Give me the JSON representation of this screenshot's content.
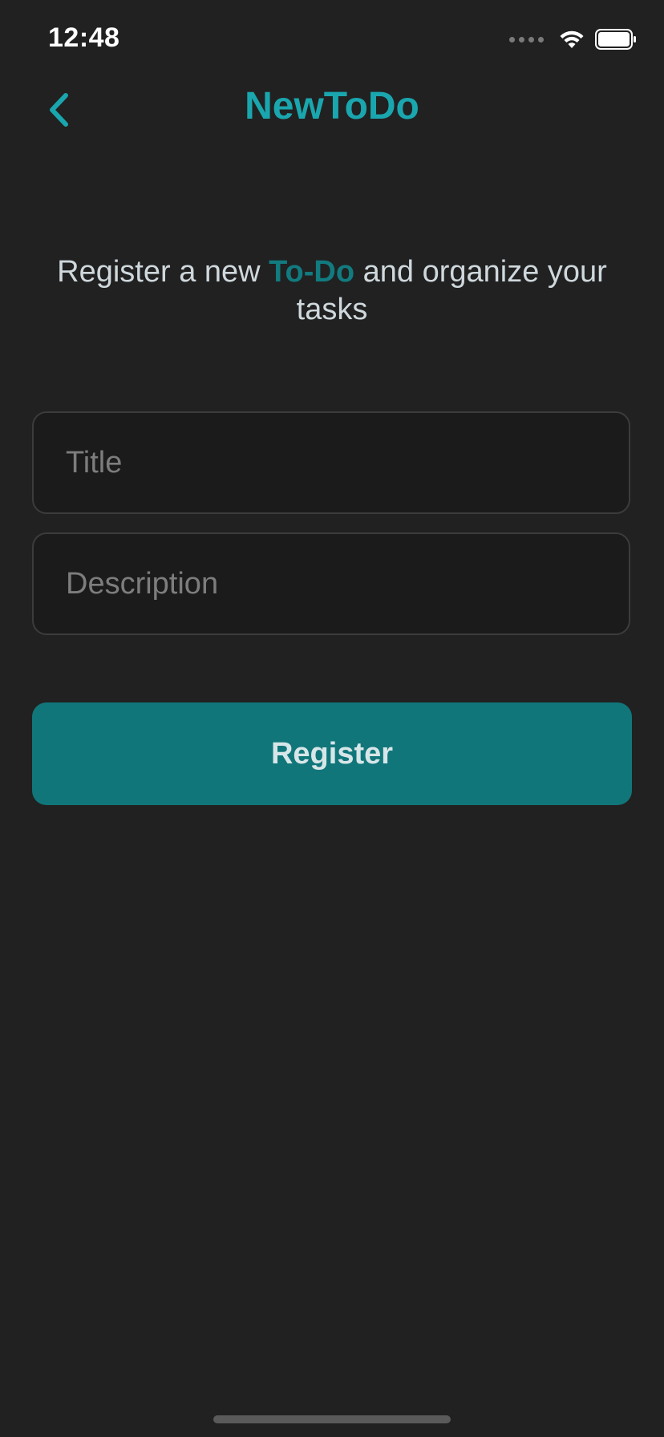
{
  "status_bar": {
    "time": "12:48",
    "signal_icon": "cellular-signal-icon",
    "wifi_icon": "wifi-icon",
    "battery_icon": "battery-icon"
  },
  "nav": {
    "title": "NewToDo",
    "back_icon": "chevron-left-icon"
  },
  "intro": {
    "prefix": "Register a new ",
    "highlight": "To-Do",
    "suffix": " and organize your tasks"
  },
  "form": {
    "title_placeholder": "Title",
    "title_value": "",
    "description_placeholder": "Description",
    "description_value": ""
  },
  "actions": {
    "register_label": "Register"
  },
  "colors": {
    "background": "#212121",
    "accent": "#1aa6ae",
    "button": "#10767a",
    "highlight": "#117b80"
  }
}
